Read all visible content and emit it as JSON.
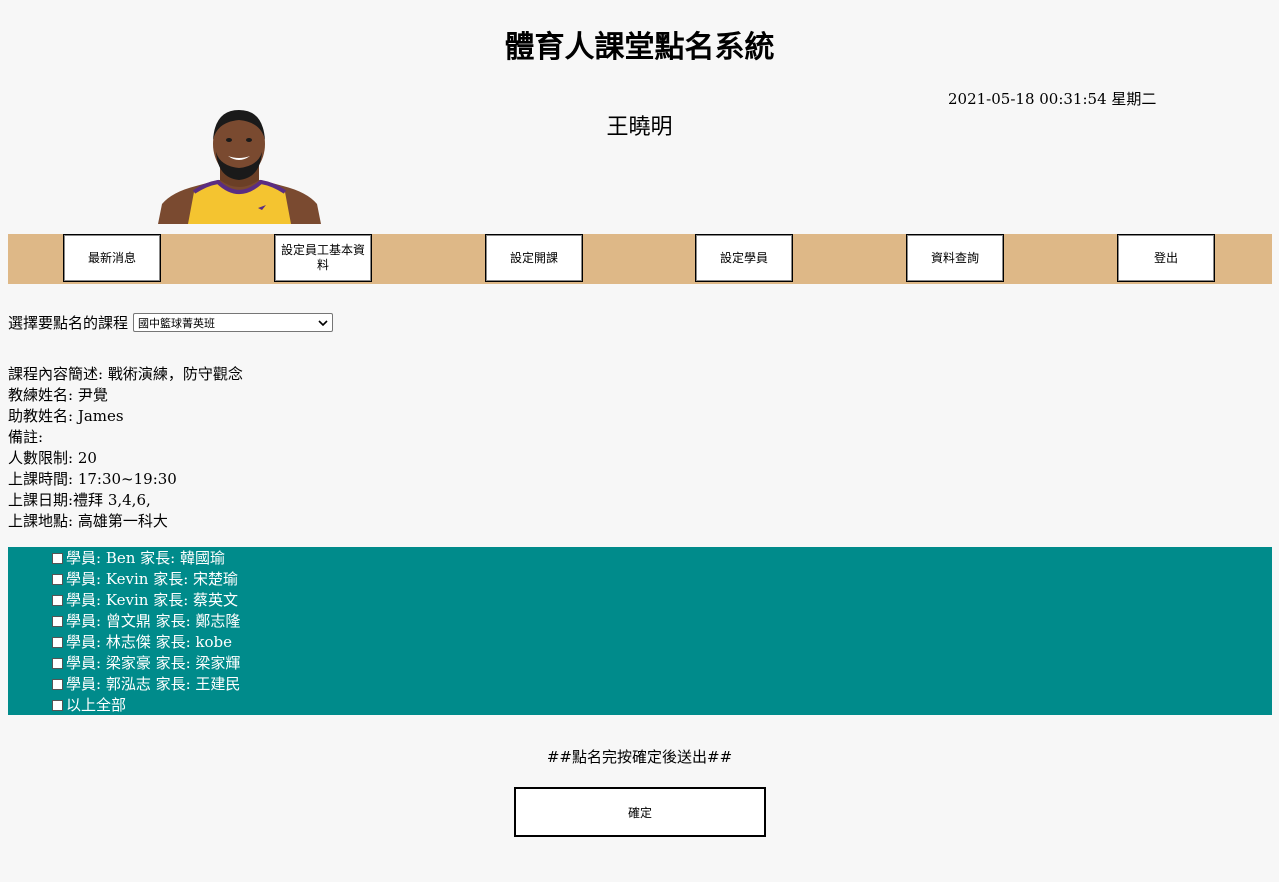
{
  "header": {
    "title": "體育人課堂點名系統",
    "datetime": "2021-05-18 00:31:54 星期二",
    "username": "王曉明"
  },
  "nav": {
    "items": [
      {
        "label": "最新消息"
      },
      {
        "label": "設定員工基本資料"
      },
      {
        "label": "設定開課"
      },
      {
        "label": "設定學員"
      },
      {
        "label": "資料查詢"
      },
      {
        "label": "登出"
      }
    ]
  },
  "course_select": {
    "label": "選擇要點名的課程",
    "selected": "國中籃球菁英班"
  },
  "course_info": {
    "description": "課程內容簡述: 戰術演練，防守觀念",
    "coach": "教練姓名: 尹覺",
    "assistant": "助教姓名: James",
    "remark": "備註:",
    "limit": "人數限制: 20",
    "time": "上課時間: 17:30~19:30",
    "days": "上課日期:禮拜 3,4,6,",
    "location": "上課地點: 高雄第一科大"
  },
  "students": [
    {
      "label": "學員: Ben 家長: 韓國瑜"
    },
    {
      "label": "學員: Kevin 家長: 宋楚瑜"
    },
    {
      "label": "學員: Kevin 家長: 蔡英文"
    },
    {
      "label": "學員: 曾文鼎 家長: 鄭志隆"
    },
    {
      "label": "學員: 林志傑 家長: kobe"
    },
    {
      "label": "學員: 梁家豪 家長: 梁家輝"
    },
    {
      "label": "學員: 郭泓志 家長: 王建民"
    }
  ],
  "select_all_label": "以上全部",
  "note": "##點名完按確定後送出##",
  "confirm_label": "確定",
  "colors": {
    "navbar": "#deb887",
    "student_panel": "#008b8b"
  }
}
